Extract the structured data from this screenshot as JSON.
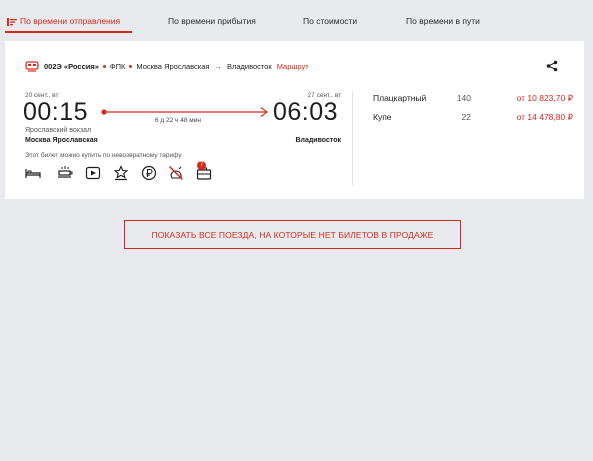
{
  "sort_tabs": [
    {
      "label": "По времени отправления",
      "active": true
    },
    {
      "label": "По времени прибытия",
      "active": false
    },
    {
      "label": "По стоимости",
      "active": false
    },
    {
      "label": "По времени в пути",
      "active": false
    }
  ],
  "accent_color": "#d52b1e",
  "train": {
    "number": "002Э «Россия»",
    "carrier": "ФПК",
    "from_station_route": "Москва Ярославская",
    "to_station_route": "Владивосток",
    "route_link": "Маршрут",
    "arrow": "→"
  },
  "departure": {
    "date": "20 сент., вт",
    "time": "00:15",
    "station": "Ярославский вокзал",
    "city": "Москва Ярославская"
  },
  "arrival": {
    "date": "27 сент., вт",
    "time": "06:03",
    "city": "Владивосток"
  },
  "duration": "6 д 22 ч 48 мин",
  "nonrefundable_note": "Этот билет можно купить по невозвратному тарифу",
  "amenities": [
    "bed-icon",
    "food-icon",
    "media-icon",
    "vip-icon",
    "ruble-icon",
    "no-pets-icon",
    "luggage-icon"
  ],
  "amenity_badge": "7",
  "fares": [
    {
      "class": "Плацкартный",
      "seats": "140",
      "price": "от 10 823,70 ₽"
    },
    {
      "class": "Купе",
      "seats": "22",
      "price": "от 14 478,80 ₽"
    }
  ],
  "show_all_button": "ПОКАЗАТЬ ВСЕ ПОЕЗДА, НА КОТОРЫЕ НЕТ БИЛЕТОВ В ПРОДАЖЕ"
}
